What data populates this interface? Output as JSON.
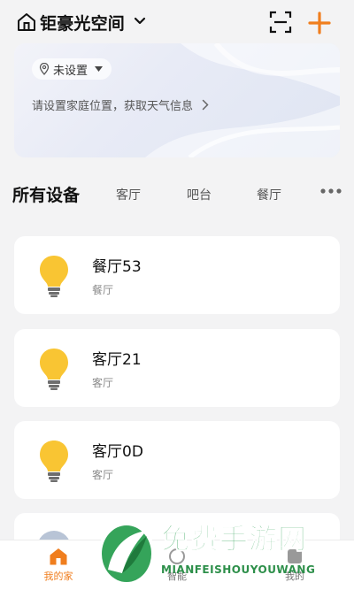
{
  "header": {
    "home_name": "钜豪光空间"
  },
  "colors": {
    "accent": "#f07e1e",
    "bulb": "#f9c533",
    "watermark_green": "#35a45a"
  },
  "weather_card": {
    "location_label": "未设置",
    "hint": "请设置家庭位置，获取天气信息"
  },
  "device_tabs": {
    "title": "所有设备",
    "rooms": [
      "客厅",
      "吧台",
      "餐厅"
    ]
  },
  "devices": [
    {
      "name": "餐厅53",
      "room": "餐厅",
      "icon": "bulb-icon"
    },
    {
      "name": "客厅21",
      "room": "客厅",
      "icon": "bulb-icon"
    },
    {
      "name": "客厅0D",
      "room": "客厅",
      "icon": "bulb-icon"
    }
  ],
  "tabbar": {
    "items": [
      {
        "label": "我的家",
        "icon": "home-filled-icon",
        "active": true
      },
      {
        "label": "智能",
        "icon": "smart-icon",
        "active": false
      },
      {
        "label": "我的",
        "icon": "profile-icon",
        "active": false
      }
    ]
  },
  "watermark": {
    "title": "免费手游网",
    "subtitle": "MIANFEISHOUYOUWANG"
  }
}
